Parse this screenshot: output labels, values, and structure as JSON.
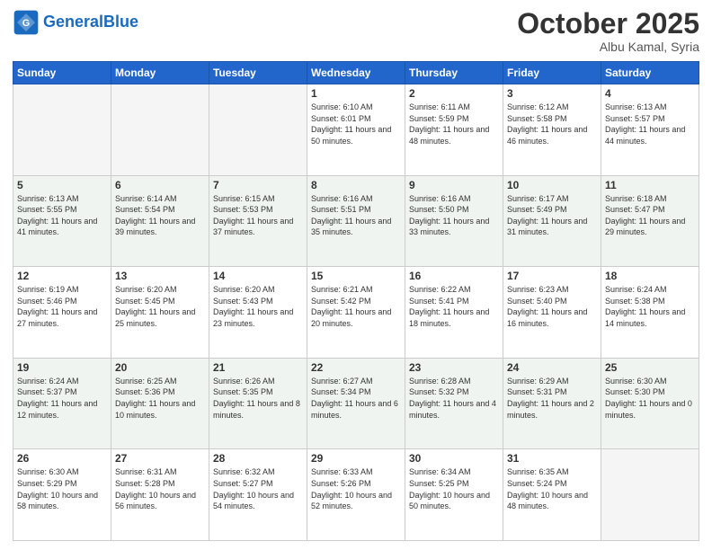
{
  "header": {
    "logo_general": "General",
    "logo_blue": "Blue",
    "title": "October 2025",
    "location": "Albu Kamal, Syria"
  },
  "days_of_week": [
    "Sunday",
    "Monday",
    "Tuesday",
    "Wednesday",
    "Thursday",
    "Friday",
    "Saturday"
  ],
  "weeks": [
    [
      {
        "day": "",
        "sunrise": "",
        "sunset": "",
        "daylight": ""
      },
      {
        "day": "",
        "sunrise": "",
        "sunset": "",
        "daylight": ""
      },
      {
        "day": "",
        "sunrise": "",
        "sunset": "",
        "daylight": ""
      },
      {
        "day": "1",
        "sunrise": "Sunrise: 6:10 AM",
        "sunset": "Sunset: 6:01 PM",
        "daylight": "Daylight: 11 hours and 50 minutes."
      },
      {
        "day": "2",
        "sunrise": "Sunrise: 6:11 AM",
        "sunset": "Sunset: 5:59 PM",
        "daylight": "Daylight: 11 hours and 48 minutes."
      },
      {
        "day": "3",
        "sunrise": "Sunrise: 6:12 AM",
        "sunset": "Sunset: 5:58 PM",
        "daylight": "Daylight: 11 hours and 46 minutes."
      },
      {
        "day": "4",
        "sunrise": "Sunrise: 6:13 AM",
        "sunset": "Sunset: 5:57 PM",
        "daylight": "Daylight: 11 hours and 44 minutes."
      }
    ],
    [
      {
        "day": "5",
        "sunrise": "Sunrise: 6:13 AM",
        "sunset": "Sunset: 5:55 PM",
        "daylight": "Daylight: 11 hours and 41 minutes."
      },
      {
        "day": "6",
        "sunrise": "Sunrise: 6:14 AM",
        "sunset": "Sunset: 5:54 PM",
        "daylight": "Daylight: 11 hours and 39 minutes."
      },
      {
        "day": "7",
        "sunrise": "Sunrise: 6:15 AM",
        "sunset": "Sunset: 5:53 PM",
        "daylight": "Daylight: 11 hours and 37 minutes."
      },
      {
        "day": "8",
        "sunrise": "Sunrise: 6:16 AM",
        "sunset": "Sunset: 5:51 PM",
        "daylight": "Daylight: 11 hours and 35 minutes."
      },
      {
        "day": "9",
        "sunrise": "Sunrise: 6:16 AM",
        "sunset": "Sunset: 5:50 PM",
        "daylight": "Daylight: 11 hours and 33 minutes."
      },
      {
        "day": "10",
        "sunrise": "Sunrise: 6:17 AM",
        "sunset": "Sunset: 5:49 PM",
        "daylight": "Daylight: 11 hours and 31 minutes."
      },
      {
        "day": "11",
        "sunrise": "Sunrise: 6:18 AM",
        "sunset": "Sunset: 5:47 PM",
        "daylight": "Daylight: 11 hours and 29 minutes."
      }
    ],
    [
      {
        "day": "12",
        "sunrise": "Sunrise: 6:19 AM",
        "sunset": "Sunset: 5:46 PM",
        "daylight": "Daylight: 11 hours and 27 minutes."
      },
      {
        "day": "13",
        "sunrise": "Sunrise: 6:20 AM",
        "sunset": "Sunset: 5:45 PM",
        "daylight": "Daylight: 11 hours and 25 minutes."
      },
      {
        "day": "14",
        "sunrise": "Sunrise: 6:20 AM",
        "sunset": "Sunset: 5:43 PM",
        "daylight": "Daylight: 11 hours and 23 minutes."
      },
      {
        "day": "15",
        "sunrise": "Sunrise: 6:21 AM",
        "sunset": "Sunset: 5:42 PM",
        "daylight": "Daylight: 11 hours and 20 minutes."
      },
      {
        "day": "16",
        "sunrise": "Sunrise: 6:22 AM",
        "sunset": "Sunset: 5:41 PM",
        "daylight": "Daylight: 11 hours and 18 minutes."
      },
      {
        "day": "17",
        "sunrise": "Sunrise: 6:23 AM",
        "sunset": "Sunset: 5:40 PM",
        "daylight": "Daylight: 11 hours and 16 minutes."
      },
      {
        "day": "18",
        "sunrise": "Sunrise: 6:24 AM",
        "sunset": "Sunset: 5:38 PM",
        "daylight": "Daylight: 11 hours and 14 minutes."
      }
    ],
    [
      {
        "day": "19",
        "sunrise": "Sunrise: 6:24 AM",
        "sunset": "Sunset: 5:37 PM",
        "daylight": "Daylight: 11 hours and 12 minutes."
      },
      {
        "day": "20",
        "sunrise": "Sunrise: 6:25 AM",
        "sunset": "Sunset: 5:36 PM",
        "daylight": "Daylight: 11 hours and 10 minutes."
      },
      {
        "day": "21",
        "sunrise": "Sunrise: 6:26 AM",
        "sunset": "Sunset: 5:35 PM",
        "daylight": "Daylight: 11 hours and 8 minutes."
      },
      {
        "day": "22",
        "sunrise": "Sunrise: 6:27 AM",
        "sunset": "Sunset: 5:34 PM",
        "daylight": "Daylight: 11 hours and 6 minutes."
      },
      {
        "day": "23",
        "sunrise": "Sunrise: 6:28 AM",
        "sunset": "Sunset: 5:32 PM",
        "daylight": "Daylight: 11 hours and 4 minutes."
      },
      {
        "day": "24",
        "sunrise": "Sunrise: 6:29 AM",
        "sunset": "Sunset: 5:31 PM",
        "daylight": "Daylight: 11 hours and 2 minutes."
      },
      {
        "day": "25",
        "sunrise": "Sunrise: 6:30 AM",
        "sunset": "Sunset: 5:30 PM",
        "daylight": "Daylight: 11 hours and 0 minutes."
      }
    ],
    [
      {
        "day": "26",
        "sunrise": "Sunrise: 6:30 AM",
        "sunset": "Sunset: 5:29 PM",
        "daylight": "Daylight: 10 hours and 58 minutes."
      },
      {
        "day": "27",
        "sunrise": "Sunrise: 6:31 AM",
        "sunset": "Sunset: 5:28 PM",
        "daylight": "Daylight: 10 hours and 56 minutes."
      },
      {
        "day": "28",
        "sunrise": "Sunrise: 6:32 AM",
        "sunset": "Sunset: 5:27 PM",
        "daylight": "Daylight: 10 hours and 54 minutes."
      },
      {
        "day": "29",
        "sunrise": "Sunrise: 6:33 AM",
        "sunset": "Sunset: 5:26 PM",
        "daylight": "Daylight: 10 hours and 52 minutes."
      },
      {
        "day": "30",
        "sunrise": "Sunrise: 6:34 AM",
        "sunset": "Sunset: 5:25 PM",
        "daylight": "Daylight: 10 hours and 50 minutes."
      },
      {
        "day": "31",
        "sunrise": "Sunrise: 6:35 AM",
        "sunset": "Sunset: 5:24 PM",
        "daylight": "Daylight: 10 hours and 48 minutes."
      },
      {
        "day": "",
        "sunrise": "",
        "sunset": "",
        "daylight": ""
      }
    ]
  ]
}
